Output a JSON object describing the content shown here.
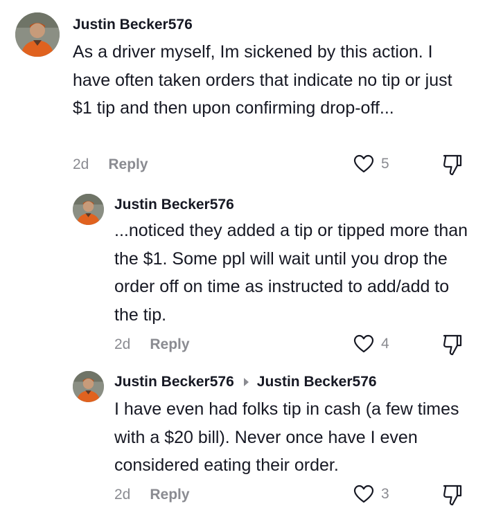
{
  "comments": [
    {
      "username": "Justin Becker576",
      "reply_to": "",
      "text": "As a driver myself, Im sickened by this action. I have often taken orders that indicate no tip or just $1 tip and then upon confirming drop-off...",
      "date": "2d",
      "reply_label": "Reply",
      "likes": "5"
    },
    {
      "username": "Justin Becker576",
      "reply_to": "",
      "text": "...noticed they added a tip or tipped more than the $1. Some ppl will wait until you drop the order off on time as instructed to add/add to the tip.",
      "date": "2d",
      "reply_label": "Reply",
      "likes": "4"
    },
    {
      "username": "Justin Becker576",
      "reply_to": "Justin Becker576",
      "text": "I have even had folks tip in cash (a few times with a $20 bill). Never once have I even considered eating their order.",
      "date": "2d",
      "reply_label": "Reply",
      "likes": "3"
    }
  ],
  "icons": {
    "like": "heart-outline-icon",
    "dislike": "thumbs-down-outline-icon",
    "reply_arrow": "triangle-right-icon"
  },
  "colors": {
    "primary_text": "#161823",
    "secondary_text": "#8a8b91",
    "avatar_shirt": "#e0621f"
  }
}
